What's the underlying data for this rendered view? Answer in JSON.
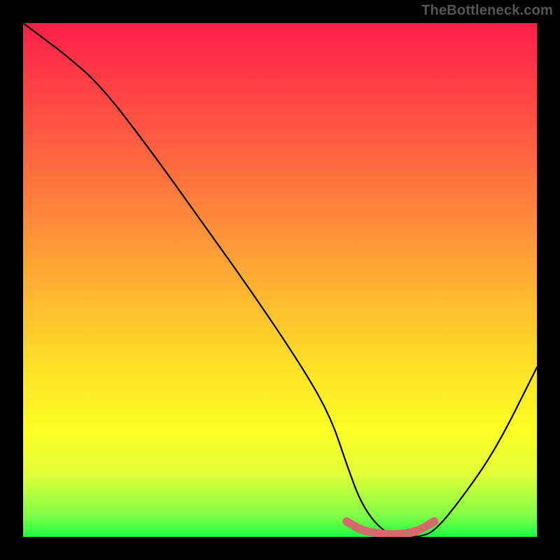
{
  "watermark": "TheBottleneck.com",
  "chart_data": {
    "type": "line",
    "title": "",
    "xlabel": "",
    "ylabel": "",
    "xlim": [
      0,
      100
    ],
    "ylim": [
      0,
      100
    ],
    "grid": false,
    "legend": false,
    "series": [
      {
        "name": "bottleneck-curve",
        "color": "#000000",
        "x": [
          0,
          4,
          8,
          15,
          25,
          35,
          45,
          55,
          60,
          63,
          66,
          70,
          74,
          77,
          80,
          85,
          92,
          100
        ],
        "values": [
          100,
          97,
          94,
          88,
          75,
          61,
          47,
          32,
          23,
          14,
          6,
          1,
          0,
          0,
          1,
          7,
          17,
          33
        ]
      },
      {
        "name": "target-band",
        "color": "#d46a6a",
        "x": [
          63,
          66,
          70,
          74,
          77,
          80
        ],
        "values": [
          3,
          1.2,
          0.5,
          0.5,
          1.2,
          3
        ]
      }
    ],
    "gradient_stops": [
      {
        "pos": 0,
        "color": "#ff1f4a"
      },
      {
        "pos": 8,
        "color": "#ff3547"
      },
      {
        "pos": 22,
        "color": "#ff5a43"
      },
      {
        "pos": 38,
        "color": "#ff8a3a"
      },
      {
        "pos": 52,
        "color": "#ffb431"
      },
      {
        "pos": 67,
        "color": "#ffe128"
      },
      {
        "pos": 80,
        "color": "#fbff25"
      },
      {
        "pos": 88,
        "color": "#e0ff3a"
      },
      {
        "pos": 96,
        "color": "#7eff47"
      },
      {
        "pos": 100,
        "color": "#1cff44"
      }
    ]
  }
}
